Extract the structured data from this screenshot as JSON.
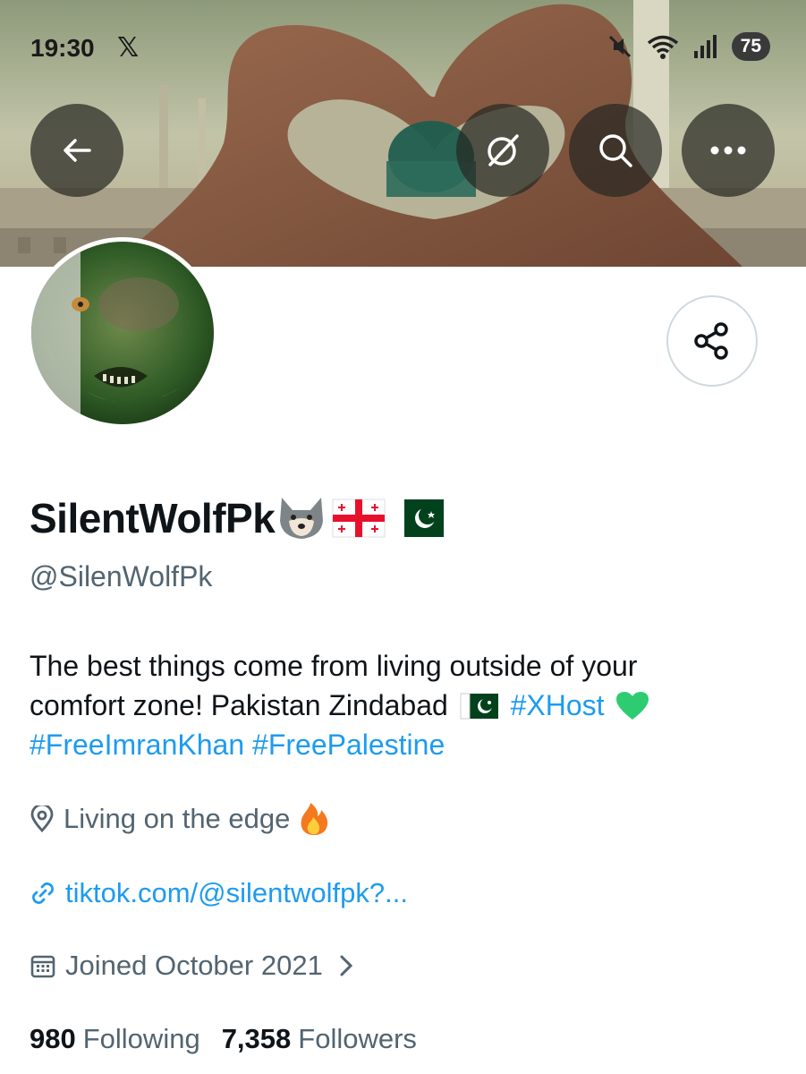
{
  "status_bar": {
    "time": "19:30",
    "app_glyph": "𝕏",
    "icons": [
      "mute-icon",
      "wifi-icon",
      "signal-icon"
    ],
    "battery": "75"
  },
  "header": {
    "back_icon": "back-arrow-icon",
    "grok_icon": "grok-icon",
    "search_icon": "search-icon",
    "more_icon": "more-icon"
  },
  "profile": {
    "display_name": "SilentWolfPk",
    "name_emojis": [
      "wolf-emoji",
      "georgia-flag",
      "pakistan-flag"
    ],
    "handle": "@SilenWolfPk",
    "bio": {
      "line1": "The best things come from living outside of your",
      "line2_text": "comfort zone! Pakistan Zindabad",
      "hashtag_xhost": "#XHost",
      "hashtag_freeimrankhan": "#FreeImranKhan",
      "hashtag_freepalestine": "#FreePalestine"
    },
    "location": "Living on the edge",
    "website": "tiktok.com/@silentwolfpk?...",
    "joined": "Joined October 2021",
    "following_count": "980",
    "following_label": "Following",
    "followers_count": "7,358",
    "followers_label": "Followers"
  },
  "colors": {
    "link": "#1d9bf0",
    "secondary_text": "#536471",
    "primary_text": "#0f1419"
  }
}
